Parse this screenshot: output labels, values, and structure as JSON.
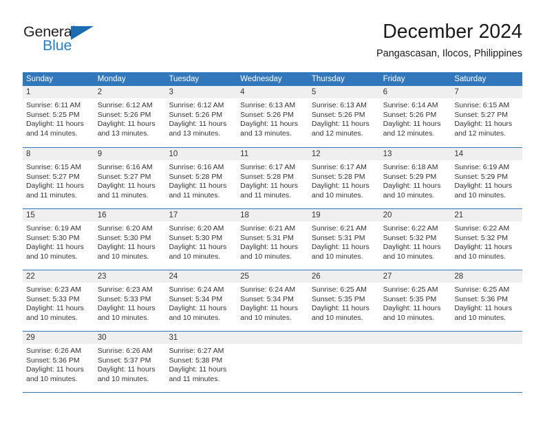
{
  "brand": {
    "name_top": "General",
    "name_bottom": "Blue",
    "triangle_icon": "triangle-icon",
    "color_dark": "#231f20",
    "color_blue": "#2b7cc4"
  },
  "header": {
    "title": "December 2024",
    "subtitle": "Pangascasan, Ilocos, Philippines"
  },
  "theme": {
    "header_bar": "#3277bc",
    "day_band": "#efefef",
    "rule": "#2f72b8",
    "text": "#333333"
  },
  "weekdays": [
    "Sunday",
    "Monday",
    "Tuesday",
    "Wednesday",
    "Thursday",
    "Friday",
    "Saturday"
  ],
  "weeks": [
    [
      {
        "day": "1",
        "sunrise": "Sunrise: 6:11 AM",
        "sunset": "Sunset: 5:25 PM",
        "daylight1": "Daylight: 11 hours",
        "daylight2": "and 14 minutes."
      },
      {
        "day": "2",
        "sunrise": "Sunrise: 6:12 AM",
        "sunset": "Sunset: 5:26 PM",
        "daylight1": "Daylight: 11 hours",
        "daylight2": "and 13 minutes."
      },
      {
        "day": "3",
        "sunrise": "Sunrise: 6:12 AM",
        "sunset": "Sunset: 5:26 PM",
        "daylight1": "Daylight: 11 hours",
        "daylight2": "and 13 minutes."
      },
      {
        "day": "4",
        "sunrise": "Sunrise: 6:13 AM",
        "sunset": "Sunset: 5:26 PM",
        "daylight1": "Daylight: 11 hours",
        "daylight2": "and 13 minutes."
      },
      {
        "day": "5",
        "sunrise": "Sunrise: 6:13 AM",
        "sunset": "Sunset: 5:26 PM",
        "daylight1": "Daylight: 11 hours",
        "daylight2": "and 12 minutes."
      },
      {
        "day": "6",
        "sunrise": "Sunrise: 6:14 AM",
        "sunset": "Sunset: 5:26 PM",
        "daylight1": "Daylight: 11 hours",
        "daylight2": "and 12 minutes."
      },
      {
        "day": "7",
        "sunrise": "Sunrise: 6:15 AM",
        "sunset": "Sunset: 5:27 PM",
        "daylight1": "Daylight: 11 hours",
        "daylight2": "and 12 minutes."
      }
    ],
    [
      {
        "day": "8",
        "sunrise": "Sunrise: 6:15 AM",
        "sunset": "Sunset: 5:27 PM",
        "daylight1": "Daylight: 11 hours",
        "daylight2": "and 11 minutes."
      },
      {
        "day": "9",
        "sunrise": "Sunrise: 6:16 AM",
        "sunset": "Sunset: 5:27 PM",
        "daylight1": "Daylight: 11 hours",
        "daylight2": "and 11 minutes."
      },
      {
        "day": "10",
        "sunrise": "Sunrise: 6:16 AM",
        "sunset": "Sunset: 5:28 PM",
        "daylight1": "Daylight: 11 hours",
        "daylight2": "and 11 minutes."
      },
      {
        "day": "11",
        "sunrise": "Sunrise: 6:17 AM",
        "sunset": "Sunset: 5:28 PM",
        "daylight1": "Daylight: 11 hours",
        "daylight2": "and 11 minutes."
      },
      {
        "day": "12",
        "sunrise": "Sunrise: 6:17 AM",
        "sunset": "Sunset: 5:28 PM",
        "daylight1": "Daylight: 11 hours",
        "daylight2": "and 10 minutes."
      },
      {
        "day": "13",
        "sunrise": "Sunrise: 6:18 AM",
        "sunset": "Sunset: 5:29 PM",
        "daylight1": "Daylight: 11 hours",
        "daylight2": "and 10 minutes."
      },
      {
        "day": "14",
        "sunrise": "Sunrise: 6:19 AM",
        "sunset": "Sunset: 5:29 PM",
        "daylight1": "Daylight: 11 hours",
        "daylight2": "and 10 minutes."
      }
    ],
    [
      {
        "day": "15",
        "sunrise": "Sunrise: 6:19 AM",
        "sunset": "Sunset: 5:30 PM",
        "daylight1": "Daylight: 11 hours",
        "daylight2": "and 10 minutes."
      },
      {
        "day": "16",
        "sunrise": "Sunrise: 6:20 AM",
        "sunset": "Sunset: 5:30 PM",
        "daylight1": "Daylight: 11 hours",
        "daylight2": "and 10 minutes."
      },
      {
        "day": "17",
        "sunrise": "Sunrise: 6:20 AM",
        "sunset": "Sunset: 5:30 PM",
        "daylight1": "Daylight: 11 hours",
        "daylight2": "and 10 minutes."
      },
      {
        "day": "18",
        "sunrise": "Sunrise: 6:21 AM",
        "sunset": "Sunset: 5:31 PM",
        "daylight1": "Daylight: 11 hours",
        "daylight2": "and 10 minutes."
      },
      {
        "day": "19",
        "sunrise": "Sunrise: 6:21 AM",
        "sunset": "Sunset: 5:31 PM",
        "daylight1": "Daylight: 11 hours",
        "daylight2": "and 10 minutes."
      },
      {
        "day": "20",
        "sunrise": "Sunrise: 6:22 AM",
        "sunset": "Sunset: 5:32 PM",
        "daylight1": "Daylight: 11 hours",
        "daylight2": "and 10 minutes."
      },
      {
        "day": "21",
        "sunrise": "Sunrise: 6:22 AM",
        "sunset": "Sunset: 5:32 PM",
        "daylight1": "Daylight: 11 hours",
        "daylight2": "and 10 minutes."
      }
    ],
    [
      {
        "day": "22",
        "sunrise": "Sunrise: 6:23 AM",
        "sunset": "Sunset: 5:33 PM",
        "daylight1": "Daylight: 11 hours",
        "daylight2": "and 10 minutes."
      },
      {
        "day": "23",
        "sunrise": "Sunrise: 6:23 AM",
        "sunset": "Sunset: 5:33 PM",
        "daylight1": "Daylight: 11 hours",
        "daylight2": "and 10 minutes."
      },
      {
        "day": "24",
        "sunrise": "Sunrise: 6:24 AM",
        "sunset": "Sunset: 5:34 PM",
        "daylight1": "Daylight: 11 hours",
        "daylight2": "and 10 minutes."
      },
      {
        "day": "25",
        "sunrise": "Sunrise: 6:24 AM",
        "sunset": "Sunset: 5:34 PM",
        "daylight1": "Daylight: 11 hours",
        "daylight2": "and 10 minutes."
      },
      {
        "day": "26",
        "sunrise": "Sunrise: 6:25 AM",
        "sunset": "Sunset: 5:35 PM",
        "daylight1": "Daylight: 11 hours",
        "daylight2": "and 10 minutes."
      },
      {
        "day": "27",
        "sunrise": "Sunrise: 6:25 AM",
        "sunset": "Sunset: 5:35 PM",
        "daylight1": "Daylight: 11 hours",
        "daylight2": "and 10 minutes."
      },
      {
        "day": "28",
        "sunrise": "Sunrise: 6:25 AM",
        "sunset": "Sunset: 5:36 PM",
        "daylight1": "Daylight: 11 hours",
        "daylight2": "and 10 minutes."
      }
    ],
    [
      {
        "day": "29",
        "sunrise": "Sunrise: 6:26 AM",
        "sunset": "Sunset: 5:36 PM",
        "daylight1": "Daylight: 11 hours",
        "daylight2": "and 10 minutes."
      },
      {
        "day": "30",
        "sunrise": "Sunrise: 6:26 AM",
        "sunset": "Sunset: 5:37 PM",
        "daylight1": "Daylight: 11 hours",
        "daylight2": "and 10 minutes."
      },
      {
        "day": "31",
        "sunrise": "Sunrise: 6:27 AM",
        "sunset": "Sunset: 5:38 PM",
        "daylight1": "Daylight: 11 hours",
        "daylight2": "and 11 minutes."
      },
      {
        "day": "",
        "sunrise": "",
        "sunset": "",
        "daylight1": "",
        "daylight2": ""
      },
      {
        "day": "",
        "sunrise": "",
        "sunset": "",
        "daylight1": "",
        "daylight2": ""
      },
      {
        "day": "",
        "sunrise": "",
        "sunset": "",
        "daylight1": "",
        "daylight2": ""
      },
      {
        "day": "",
        "sunrise": "",
        "sunset": "",
        "daylight1": "",
        "daylight2": ""
      }
    ]
  ]
}
